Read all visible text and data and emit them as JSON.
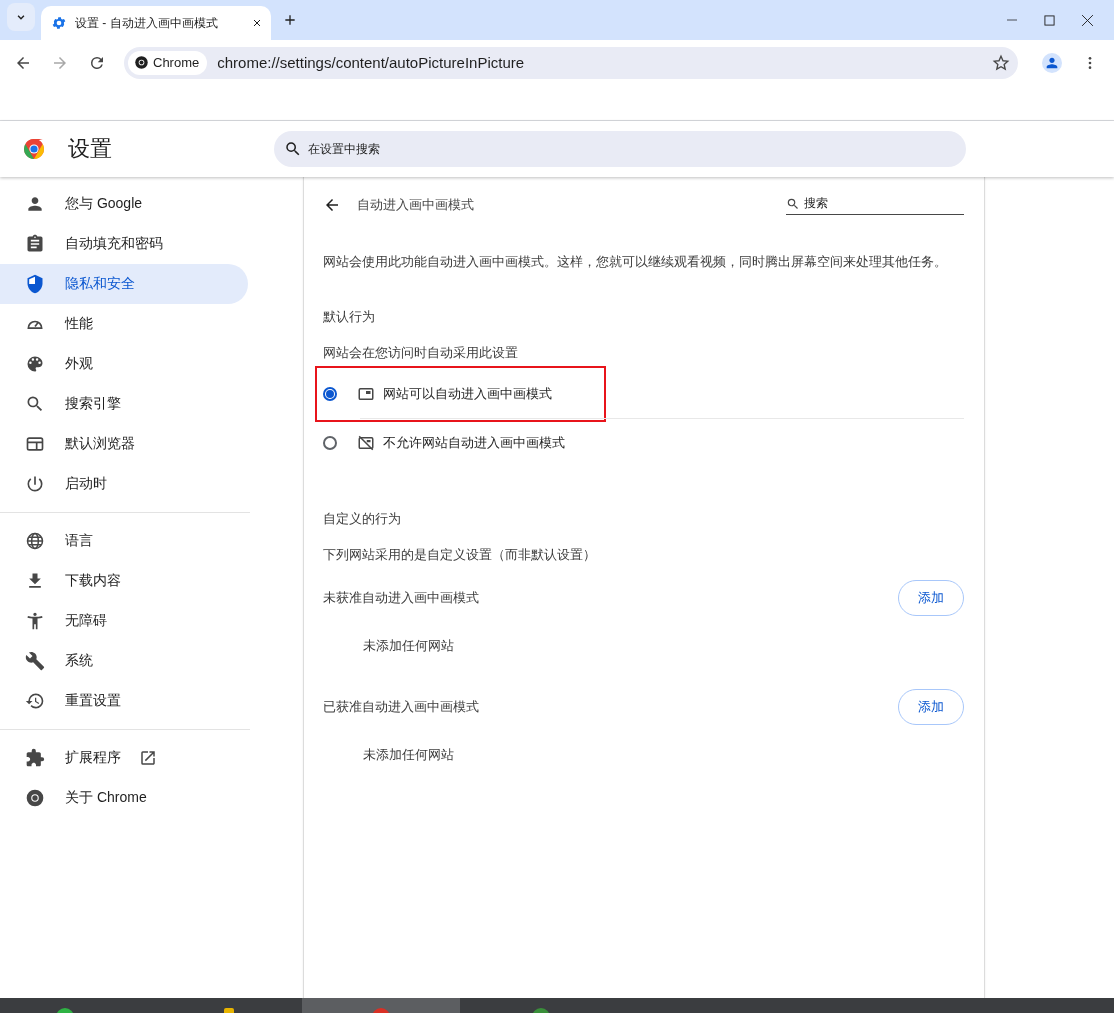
{
  "window": {
    "tab_title": "设置 - 自动进入画中画模式"
  },
  "address_bar": {
    "chip": "Chrome",
    "url": "chrome://settings/content/autoPictureInPicture"
  },
  "header": {
    "title": "设置",
    "search": {
      "placeholder": "在设置中搜索"
    }
  },
  "sidebar": {
    "groups": [
      {
        "items": [
          {
            "label": "您与 Google",
            "selected": false,
            "external": false
          },
          {
            "label": "自动填充和密码",
            "selected": false,
            "external": false
          },
          {
            "label": "隐私和安全",
            "selected": true,
            "external": false
          },
          {
            "label": "性能",
            "selected": false,
            "external": false
          },
          {
            "label": "外观",
            "selected": false,
            "external": false
          },
          {
            "label": "搜索引擎",
            "selected": false,
            "external": false
          },
          {
            "label": "默认浏览器",
            "selected": false,
            "external": false
          },
          {
            "label": "启动时",
            "selected": false,
            "external": false
          }
        ]
      },
      {
        "items": [
          {
            "label": "语言",
            "selected": false,
            "external": false
          },
          {
            "label": "下载内容",
            "selected": false,
            "external": false
          },
          {
            "label": "无障碍",
            "selected": false,
            "external": false
          },
          {
            "label": "系统",
            "selected": false,
            "external": false
          },
          {
            "label": "重置设置",
            "selected": false,
            "external": false
          }
        ]
      },
      {
        "items": [
          {
            "label": "扩展程序",
            "selected": false,
            "external": true
          },
          {
            "label": "关于 Chrome",
            "selected": false,
            "external": false
          }
        ]
      }
    ]
  },
  "page": {
    "title": "自动进入画中画模式",
    "search": {
      "placeholder": "搜索"
    },
    "description": "网站会使用此功能自动进入画中画模式。这样，您就可以继续观看视频，同时腾出屏幕空间来处理其他任务。",
    "default_section": {
      "title": "默认行为",
      "subtitle": "网站会在您访问时自动采用此设置",
      "options": [
        {
          "label": "网站可以自动进入画中画模式",
          "selected": true,
          "highlighted": true
        },
        {
          "label": "不允许网站自动进入画中画模式",
          "selected": false,
          "highlighted": false
        }
      ]
    },
    "custom_section": {
      "title": "自定义的行为",
      "subtitle": "下列网站采用的是自定义设置（而非默认设置）",
      "lists": [
        {
          "title": "未获准自动进入画中画模式",
          "button": "添加",
          "empty": "未添加任何网站"
        },
        {
          "title": "已获准自动进入画中画模式",
          "button": "添加",
          "empty": "未添加任何网站"
        }
      ]
    }
  }
}
